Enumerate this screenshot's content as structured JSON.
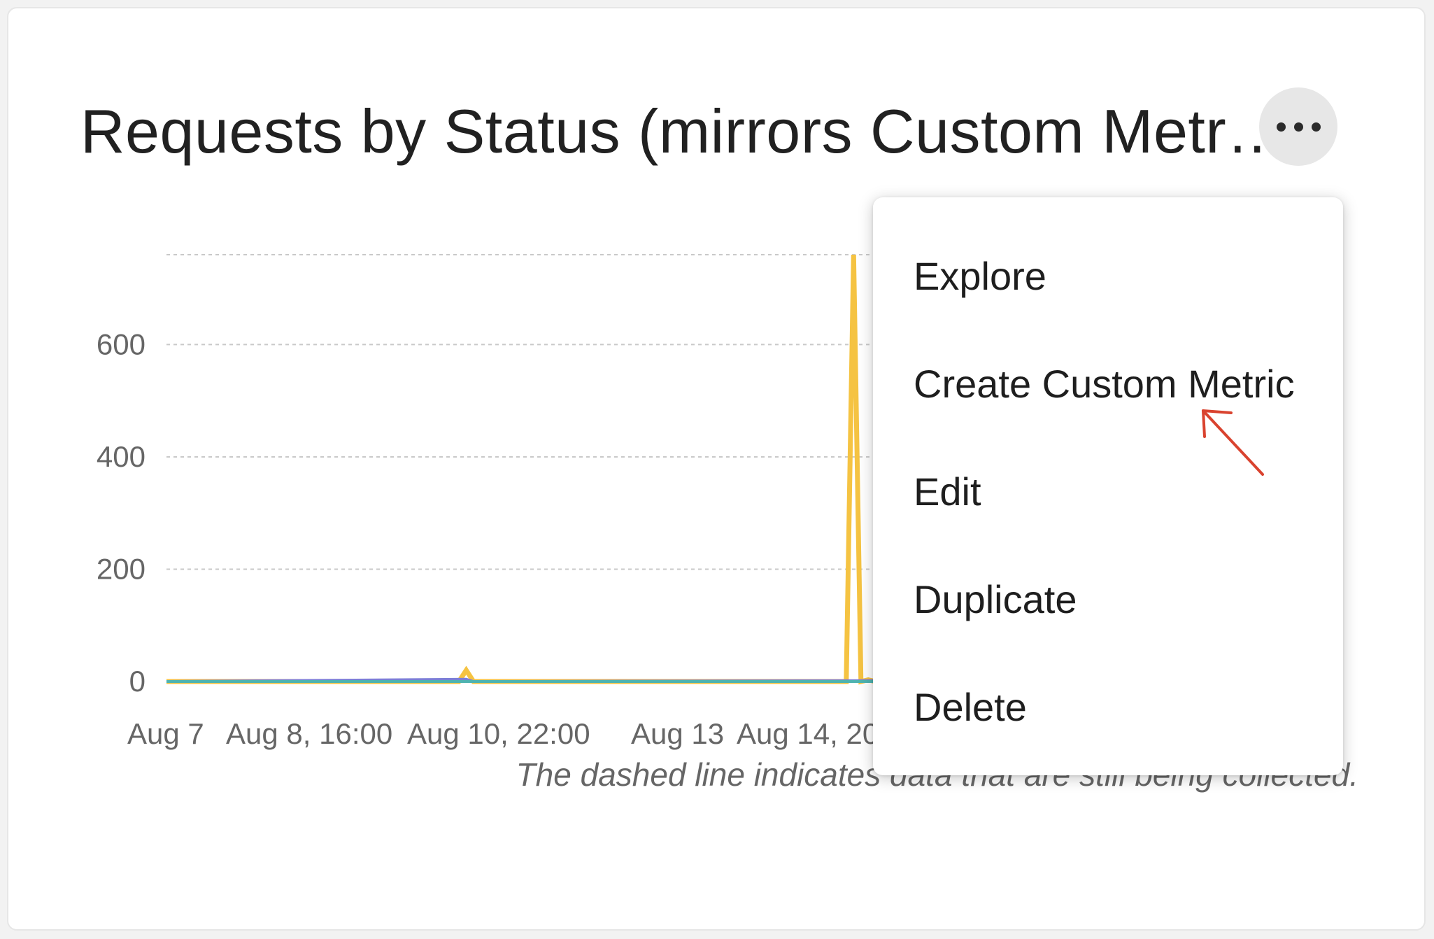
{
  "card": {
    "title": "Requests by Status (mirrors Custom Metr…",
    "more_icon": "more-horizontal-icon",
    "footnote": "The dashed line indicates data that are still being collected."
  },
  "menu": {
    "items": [
      {
        "label": "Explore"
      },
      {
        "label": "Create Custom Metric"
      },
      {
        "label": "Edit"
      },
      {
        "label": "Duplicate"
      },
      {
        "label": "Delete"
      }
    ]
  },
  "annotation": {
    "icon": "red-arrow-icon",
    "color": "#d9432f"
  },
  "chart_data": {
    "type": "line",
    "title": "",
    "xlabel": "",
    "ylabel": "",
    "ylim": [
      0,
      760
    ],
    "yticks": [
      0,
      200,
      400,
      600
    ],
    "x_tick_labels": [
      "Aug 7",
      "Aug 8, 16:00",
      "Aug 10, 22:00",
      "Aug 13",
      "Aug 14, 20"
    ],
    "grid": true,
    "series": [
      {
        "color": "#f5c342",
        "points": [
          [
            0,
            0
          ],
          [
            40,
            0
          ],
          [
            41,
            20
          ],
          [
            42,
            0
          ],
          [
            93,
            0
          ],
          [
            94,
            760
          ],
          [
            95,
            0
          ],
          [
            96,
            3
          ],
          [
            97,
            0
          ],
          [
            112,
            0
          ],
          [
            113,
            25
          ],
          [
            114,
            10
          ],
          [
            115,
            28
          ],
          [
            116,
            5
          ],
          [
            117,
            0
          ],
          [
            118,
            33
          ],
          [
            119,
            0
          ],
          [
            121,
            0
          ],
          [
            122,
            4
          ],
          [
            123,
            0
          ],
          [
            124,
            30
          ],
          [
            125,
            5
          ],
          [
            126,
            100
          ],
          [
            127,
            0
          ],
          [
            128,
            0
          ],
          [
            129,
            105
          ],
          [
            130,
            0
          ],
          [
            160,
            0
          ]
        ]
      },
      {
        "color": "#7b7fd6",
        "points": [
          [
            0,
            0
          ],
          [
            41,
            4
          ],
          [
            42,
            0
          ],
          [
            113,
            2
          ],
          [
            114,
            3
          ],
          [
            115,
            2
          ],
          [
            116,
            0
          ],
          [
            118,
            2
          ],
          [
            119,
            0
          ],
          [
            126,
            5
          ],
          [
            127,
            0
          ],
          [
            129,
            8
          ],
          [
            130,
            0
          ],
          [
            160,
            0
          ]
        ]
      },
      {
        "color": "#4fb3b0",
        "points": [
          [
            0,
            0
          ],
          [
            160,
            0
          ]
        ]
      }
    ]
  }
}
